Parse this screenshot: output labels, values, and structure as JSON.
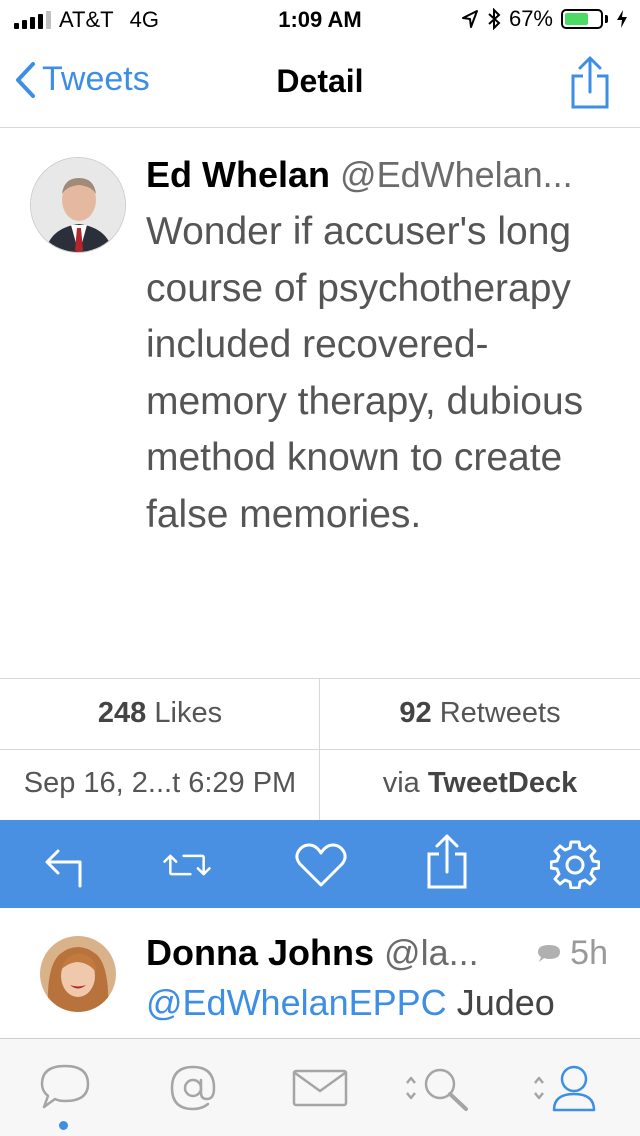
{
  "status": {
    "carrier": "AT&T",
    "network": "4G",
    "time": "1:09 AM",
    "battery": "67%",
    "battery_level": 0.67
  },
  "nav": {
    "back_label": "Tweets",
    "title": "Detail"
  },
  "tweet": {
    "name": "Ed Whelan",
    "handle": "@EdWhelan...",
    "text": "Wonder if accuser's long course of psychotherapy included recovered-memory therapy, dubious method known to create false memories.",
    "likes_count": "248",
    "likes_label": "Likes",
    "retweets_count": "92",
    "retweets_label": "Retweets",
    "date": "Sep 16, 2...t 6:29 PM",
    "via_prefix": "via",
    "via_client": "TweetDeck"
  },
  "reply": {
    "name": "Donna Johns",
    "handle": "@la...",
    "time": "5h",
    "mention": "@EdWhelanEPPC",
    "text": "Judeo"
  },
  "colors": {
    "accent": "#4a90e2",
    "link": "#3d8ee5",
    "battery": "#4cd964"
  },
  "icons": {
    "actions": [
      "reply-icon",
      "retweet-icon",
      "like-icon",
      "share-icon",
      "settings-icon"
    ],
    "tabs": [
      "timeline-icon",
      "mentions-icon",
      "messages-icon",
      "search-icon",
      "profile-icon"
    ]
  }
}
